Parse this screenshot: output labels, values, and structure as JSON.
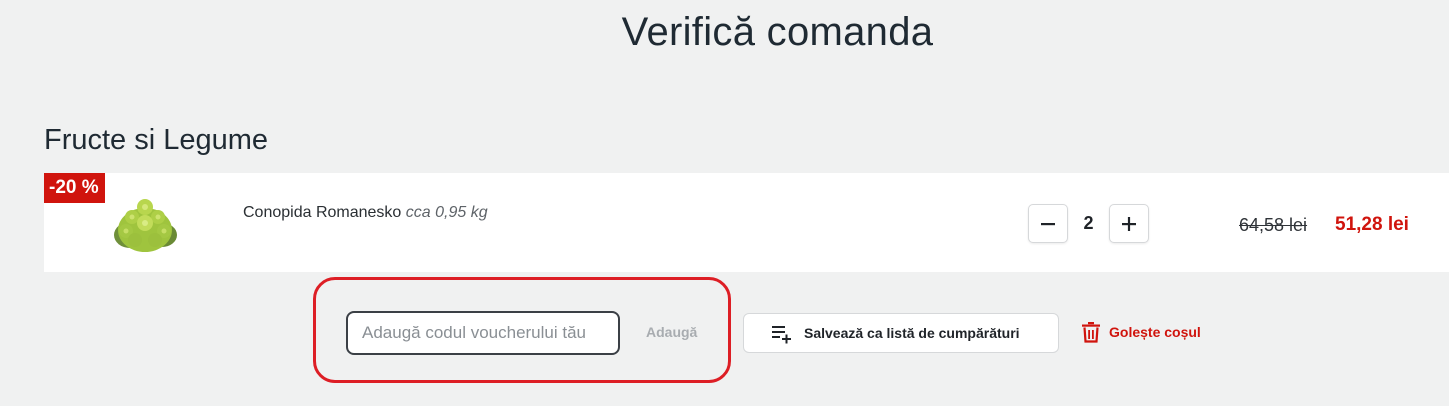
{
  "page": {
    "title": "Verifică comanda"
  },
  "category": {
    "title": "Fructe si Legume"
  },
  "product": {
    "discount_badge": "-20 %",
    "image_icon": "romanesco-cauliflower-image",
    "name": "Conopida Romanesko",
    "weight": "cca 0,95 kg",
    "quantity": "2",
    "decrement_symbol": "minus-icon",
    "increment_symbol": "plus-icon",
    "old_price": "64,58 lei",
    "new_price": "51,28 lei"
  },
  "voucher": {
    "placeholder": "Adaugă codul voucherului tău",
    "value": "",
    "add_label": "Adaugă"
  },
  "actions": {
    "save_list_label": "Salvează ca listă de cumpărături",
    "save_list_icon": "playlist-add-icon",
    "clear_cart_label": "Golește coșul",
    "clear_cart_icon": "trash-icon"
  },
  "colors": {
    "accent_red": "#d0140d",
    "highlight_red": "#dd1e25",
    "page_background": "#f0f1f1"
  }
}
